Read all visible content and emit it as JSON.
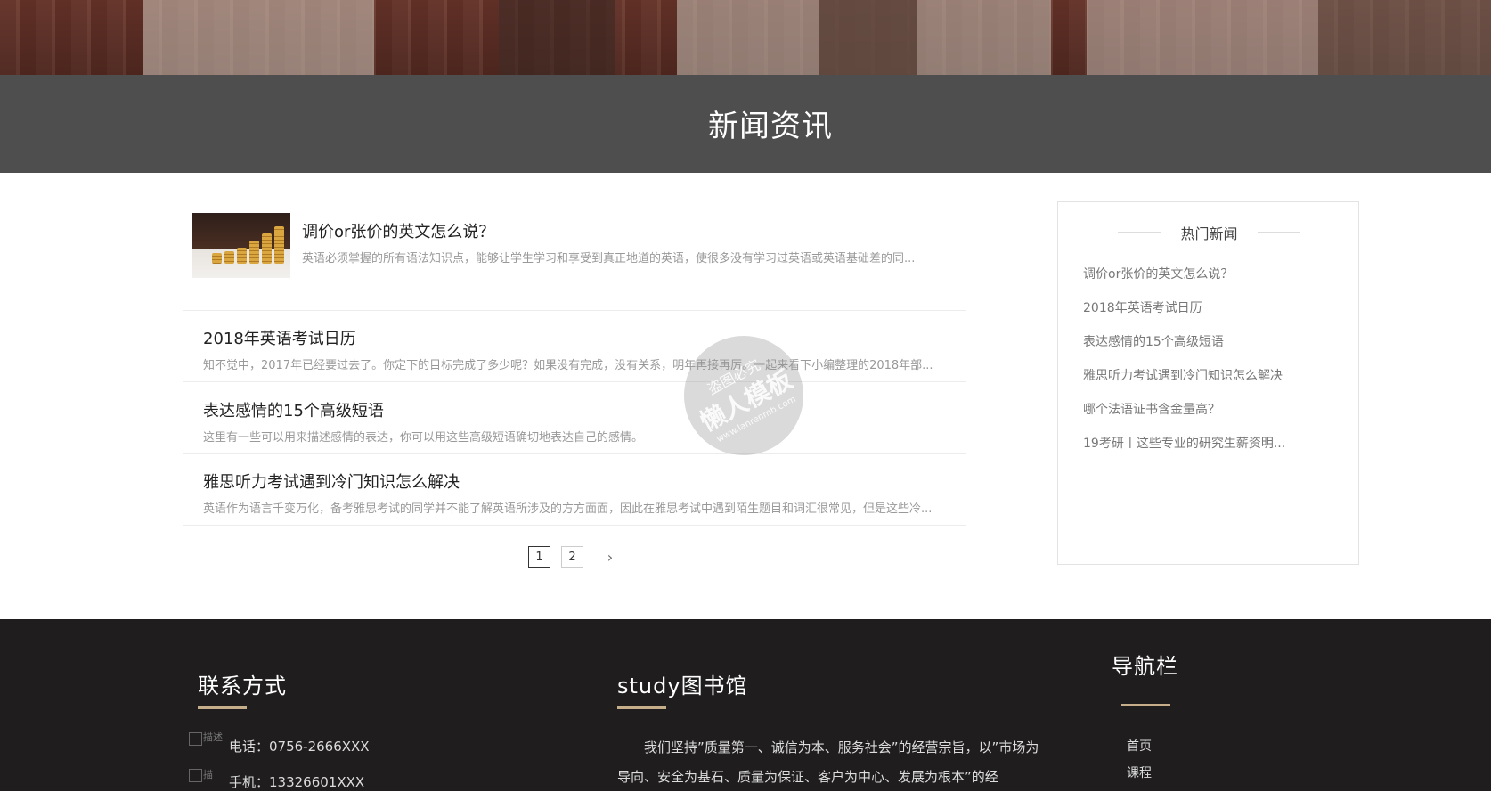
{
  "hero": {
    "title": "新闻资讯"
  },
  "news": [
    {
      "title": "调价or张价的英文怎么说？",
      "desc": "英语必须掌握的所有语法知识点，能够让学生学习和享受到真正地道的英语，使很多没有学习过英语或英语基础差的同..."
    },
    {
      "title": "2018年英语考试日历",
      "desc": "知不觉中，2017年已经要过去了。你定下的目标完成了多少呢？如果没有完成，没有关系，明年再接再厉。一起来看下小编整理的2018年部..."
    },
    {
      "title": "表达感情的15个高级短语",
      "desc": "这里有一些可以用来描述感情的表达，你可以用这些高级短语确切地表达自己的感情。"
    },
    {
      "title": "雅思听力考试遇到冷门知识怎么解决",
      "desc": "英语作为语言千变万化，备考雅思考试的同学并不能了解英语所涉及的方方面面，因此在雅思考试中遇到陌生题目和词汇很常见，但是这些冷..."
    }
  ],
  "pagination": {
    "pages": [
      "1",
      "2"
    ],
    "current": "1",
    "next": "›"
  },
  "sidebar": {
    "title": "热门新闻",
    "items": [
      "调价or张价的英文怎么说？",
      "2018年英语考试日历",
      "表达感情的15个高级短语",
      "雅思听力考试遇到冷门知识怎么解决",
      "哪个法语证书含金量高？",
      "19考研丨这些专业的研究生薪资明..."
    ]
  },
  "footer": {
    "contact": {
      "title": "联系方式",
      "phone": "电话：0756-2666XXX",
      "mobile": "手机：13326601XXX",
      "icon_alt_1": "描述",
      "icon_alt_2": "描"
    },
    "library": {
      "title": "study图书馆",
      "text": "我们坚持”质量第一、诚信为本、服务社会”的经营宗旨，以”市场为导向、安全为基石、质量为保证、客户为中心、发展为根本”的经"
    },
    "nav": {
      "title": "导航栏",
      "items": [
        "首页",
        "课程"
      ]
    }
  },
  "watermark": {
    "line1": "盗图必究",
    "line2": "懒人模板",
    "line3": "www.lanrenmb.com"
  },
  "colors": {
    "footer_bg": "#1f1d1e",
    "accent": "#c7ae8a",
    "hero_band": "#4e4e4e"
  }
}
